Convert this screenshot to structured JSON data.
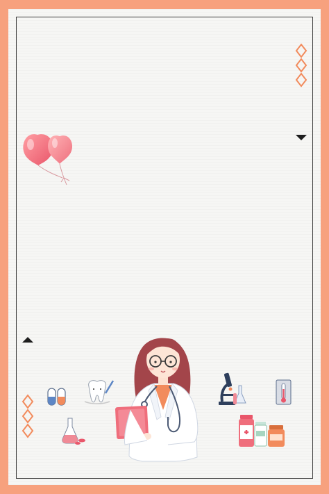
{
  "poster": {
    "theme": "medical-themed blank poster with doctor illustration",
    "colors": {
      "frame": "#f7a17e",
      "paper": "#f6f6f4",
      "border_line": "#3b3b3b",
      "balloon": "#ef6e7c",
      "accent": "#f28b5c"
    },
    "decorations": [
      "balloon-icon",
      "diamond-icon",
      "triangle-icon",
      "pill-capsule-icon",
      "tooth-icon",
      "flask-icon",
      "microscope-icon",
      "thermometer-icon",
      "medicine-bottle-icon",
      "clipboard-icon",
      "stethoscope-icon"
    ]
  }
}
